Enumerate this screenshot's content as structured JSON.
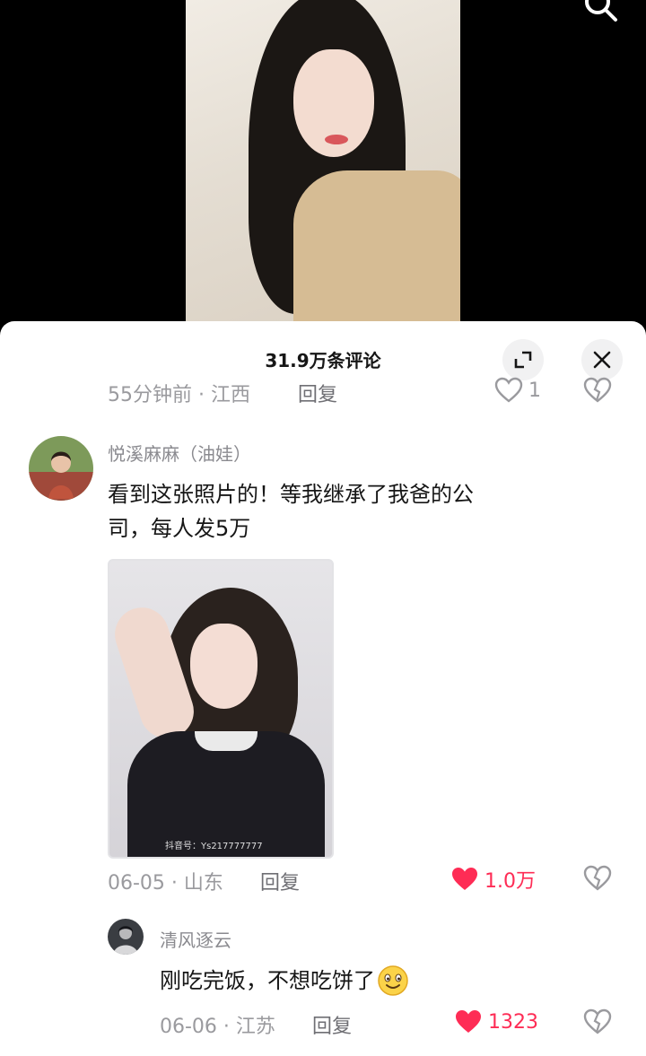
{
  "sheet": {
    "title": "31.9万条评论"
  },
  "prev_comment": {
    "time_location": "55分钟前 · 江西",
    "reply_label": "回复",
    "like_count": "1"
  },
  "comment": {
    "username": "悦溪麻麻（油娃）",
    "text_line1": "看到这张照片的！等我继承了我爸的公",
    "text_line2": "司，每人发5万",
    "image_watermark": "抖音号：Ys217777777",
    "time_location": "06-05 · 山东",
    "reply_label": "回复",
    "like_count": "1.0万"
  },
  "reply": {
    "username": "清风逐云",
    "text": "刚吃完饭，不想吃饼了",
    "time_location": "06-06 · 江苏",
    "reply_label": "回复",
    "like_count": "1323"
  },
  "colors": {
    "liked": "#fe2c55",
    "muted": "#9a9a9e"
  }
}
